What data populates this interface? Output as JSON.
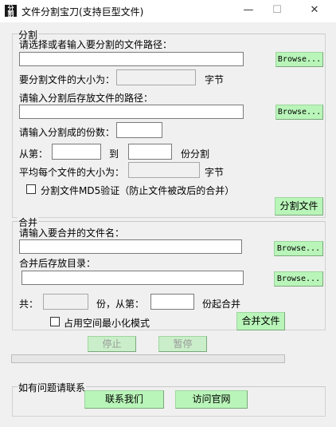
{
  "window": {
    "title": "文件分割宝刀(支持巨型文件)",
    "icon_text": "分割",
    "minimize_glyph": "—",
    "maximize_glyph": "☐",
    "close_glyph": "✕"
  },
  "split": {
    "legend": "分割",
    "path_label": "请选择或者输入要分割的文件路径：",
    "path_value": "",
    "browse1": "Browse...",
    "size_label": "要分割文件的大小为：",
    "size_value": "",
    "size_unit": "字节",
    "save_label": "请输入分割后存放文件的路径：",
    "save_value": "",
    "browse2": "Browse...",
    "parts_label": "请输入分割成的份数：",
    "parts_value": "",
    "from_label": "从第：",
    "from_value": "",
    "to_label": "到",
    "to_value": "",
    "to_suffix": "份分割",
    "avg_label": "平均每个文件的大小为：",
    "avg_value": "",
    "avg_unit": "字节",
    "md5_label": "分割文件MD5验证（防止文件被改后的合并）",
    "split_button": "分割文件"
  },
  "merge": {
    "legend": "合并",
    "file_label": "请输入要合并的文件名：",
    "file_value": "",
    "browse3": "Browse...",
    "dir_label": "合并后存放目录：",
    "dir_value": "",
    "browse4": "Browse...",
    "total_label": "共：",
    "total_value": "",
    "from_label": "份，从第：",
    "from_value": "",
    "from_suffix": "份起合并",
    "minspace_label": "占用空间最小化模式",
    "merge_button": "合并文件"
  },
  "controls": {
    "stop_button": "停止",
    "pause_button": "暂停",
    "progress_percent": 0
  },
  "contact": {
    "legend": "如有问题请联系",
    "contact_button": "联系我们",
    "website_button": "访问官网"
  }
}
